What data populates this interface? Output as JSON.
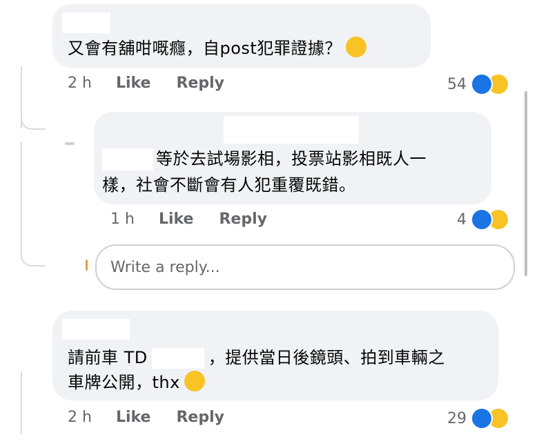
{
  "comments": [
    {
      "text_before": "又會有舖咁嘅癮，自post犯罪證據？",
      "emoji_icon": "thinking-face-emoji",
      "time": "2 h",
      "like_label": "Like",
      "reply_label": "Reply",
      "reaction_count": "54",
      "reaction_icons": [
        "like-reaction",
        "haha-reaction"
      ]
    },
    {
      "line1_after_mask": "等於去試場影相，投票站影相既人一",
      "line2": "樣，社會不斷會有人犯重覆既錯。",
      "time": "1 h",
      "like_label": "Like",
      "reply_label": "Reply",
      "reaction_count": "4",
      "reaction_icons": [
        "like-reaction",
        "haha-reaction"
      ]
    },
    {
      "line1_before_mask": "請前車 TD",
      "line1_after_mask": "，提供當日後鏡頭、拍到車輛之",
      "line2_text": "車牌公開，thx",
      "emoji_icon": "smiling-face-emoji",
      "time": "2 h",
      "like_label": "Like",
      "reply_label": "Reply",
      "reaction_count": "29",
      "reaction_icons": [
        "like-reaction",
        "haha-reaction"
      ]
    }
  ],
  "reply_box": {
    "placeholder": "Write a reply..."
  },
  "colors": {
    "bubble_bg": "#f0f2f5",
    "meta_text": "#65676b",
    "like_blue": "#1b74e4",
    "haha_yellow": "#f7c325"
  }
}
